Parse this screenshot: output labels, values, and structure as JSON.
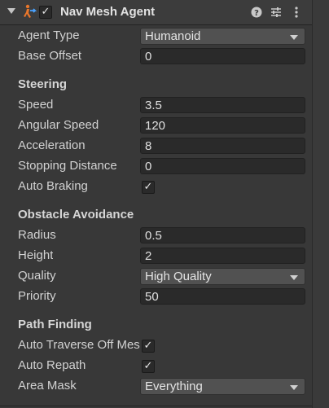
{
  "header": {
    "title": "Nav Mesh Agent",
    "enabled_check": "✓",
    "help_icon": "help-icon",
    "presets_icon": "presets-icon",
    "menu_icon": "menu-icon"
  },
  "check_glyph": "✓",
  "rows": {
    "agent_type": {
      "label": "Agent Type",
      "value": "Humanoid"
    },
    "base_offset": {
      "label": "Base Offset",
      "value": "0"
    }
  },
  "steering": {
    "heading": "Steering",
    "speed": {
      "label": "Speed",
      "value": "3.5"
    },
    "angular_speed": {
      "label": "Angular Speed",
      "value": "120"
    },
    "acceleration": {
      "label": "Acceleration",
      "value": "8"
    },
    "stopping_distance": {
      "label": "Stopping Distance",
      "value": "0"
    },
    "auto_braking": {
      "label": "Auto Braking",
      "checked": true
    }
  },
  "obstacle": {
    "heading": "Obstacle Avoidance",
    "radius": {
      "label": "Radius",
      "value": "0.5"
    },
    "height": {
      "label": "Height",
      "value": "2"
    },
    "quality": {
      "label": "Quality",
      "value": "High Quality"
    },
    "priority": {
      "label": "Priority",
      "value": "50"
    }
  },
  "path": {
    "heading": "Path Finding",
    "auto_traverse": {
      "label": "Auto Traverse Off Mesh Link",
      "checked": true
    },
    "auto_repath": {
      "label": "Auto Repath",
      "checked": true
    },
    "area_mask": {
      "label": "Area Mask",
      "value": "Everything"
    }
  },
  "colors": {
    "background": "#383838",
    "field": "#2a2a2a",
    "dropdown": "#515151",
    "icon_orange": "#e8762b",
    "icon_blue": "#4aa3ff"
  }
}
